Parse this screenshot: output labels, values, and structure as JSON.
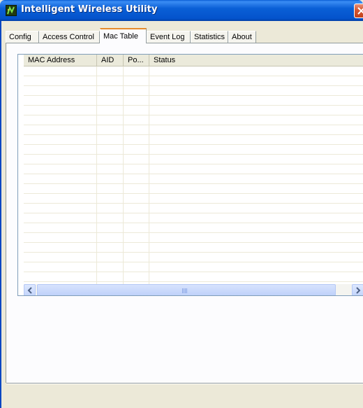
{
  "window": {
    "title": "Intelligent Wireless Utility",
    "icon": "app-icon",
    "close_icon": "close-icon"
  },
  "tabs": [
    {
      "label": "Config"
    },
    {
      "label": "Access Control"
    },
    {
      "label": "Mac Table",
      "active": true
    },
    {
      "label": "Event Log"
    },
    {
      "label": "Statistics"
    },
    {
      "label": "About"
    }
  ],
  "mac_table": {
    "columns": [
      {
        "label": "MAC Address"
      },
      {
        "label": "AID"
      },
      {
        "label": "Po..."
      },
      {
        "label": "Status"
      }
    ],
    "rows": []
  },
  "scrollbar": {
    "left_icon": "arrow-left-icon",
    "right_icon": "arrow-right-icon"
  },
  "colors": {
    "titlebar": "#0a5fd6",
    "window_bg": "#ece9d8",
    "active_tab_accent": "#e68b2c",
    "close_button": "#d6552f"
  }
}
